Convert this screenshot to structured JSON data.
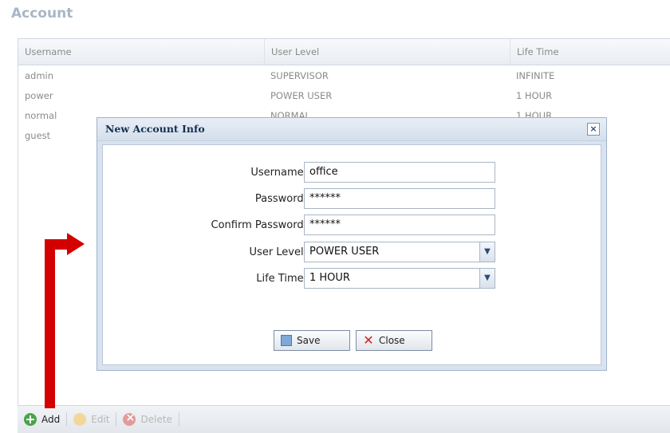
{
  "page": {
    "title": "Account"
  },
  "grid": {
    "columns": [
      "Username",
      "User Level",
      "Life Time"
    ],
    "rows": [
      [
        "admin",
        "SUPERVISOR",
        "INFINITE"
      ],
      [
        "power",
        "POWER USER",
        "1 HOUR"
      ],
      [
        "normal",
        "NORMAL",
        "1 HOUR"
      ],
      [
        "guest",
        "",
        ""
      ]
    ]
  },
  "toolbar": {
    "add": "Add",
    "edit": "Edit",
    "delete": "Delete"
  },
  "dialog": {
    "title": "New Account Info",
    "close_glyph": "×",
    "username_label": "Username:",
    "username_value": "office",
    "password_label": "Password:",
    "password_value": "******",
    "confirm_label": "Confirm Password:",
    "confirm_value": "******",
    "level_label": "User Level:",
    "level_value": "POWER USER",
    "lifetime_label": "Life Time:",
    "lifetime_value": "1 HOUR",
    "save_label": "Save",
    "close_label": "Close"
  },
  "colors": {
    "arrow": "#d40000",
    "title": "#a9b6c4",
    "dialog_title": "#15304f"
  }
}
